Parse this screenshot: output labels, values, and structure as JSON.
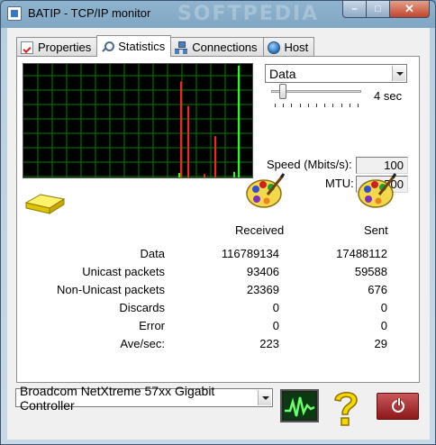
{
  "window": {
    "title": "BATIP - TCP/IP monitor",
    "watermark": "SOFTPEDIA",
    "minimize_glyph": "–",
    "maximize_glyph": "□",
    "close_glyph": "✕"
  },
  "tabs": [
    {
      "label": "Properties",
      "icon": "checklist-icon",
      "active": false
    },
    {
      "label": "Statistics",
      "icon": "magnifier-icon",
      "active": true
    },
    {
      "label": "Connections",
      "icon": "network-icon",
      "active": false
    },
    {
      "label": "Host",
      "icon": "globe-icon",
      "active": false
    }
  ],
  "statistics": {
    "view_select": "Data",
    "interval_label": "4 sec",
    "interval_slider_fraction": 0.1,
    "speed_label": "Speed (Mbits/s):",
    "speed_value": "100",
    "mtu_label": "MTU:",
    "mtu_value": "1500",
    "received_header": "Received",
    "sent_header": "Sent",
    "rows": [
      {
        "label": "Data",
        "received": "116789134",
        "sent": "17488112"
      },
      {
        "label": "Unicast packets",
        "received": "93406",
        "sent": "59588"
      },
      {
        "label": "Non-Unicast packets",
        "received": "23369",
        "sent": "676"
      },
      {
        "label": "Discards",
        "received": "0",
        "sent": "0"
      },
      {
        "label": "Error",
        "received": "0",
        "sent": "0"
      },
      {
        "label": "Ave/sec:",
        "received": "223",
        "sent": "29"
      }
    ],
    "graph": {
      "grid_color": "#008000",
      "background": "#000000",
      "received_color": "#ff2020",
      "sent_color": "#20ff20",
      "spikes": [
        {
          "pos": 0.69,
          "level": 0.86,
          "color": "red"
        },
        {
          "pos": 0.72,
          "level": 0.64,
          "color": "red"
        },
        {
          "pos": 0.84,
          "level": 0.37,
          "color": "red"
        },
        {
          "pos": 0.79,
          "level": 0.03,
          "color": "red"
        },
        {
          "pos": 0.94,
          "level": 1.0,
          "color": "green"
        },
        {
          "pos": 0.92,
          "level": 0.05,
          "color": "green"
        },
        {
          "pos": 0.68,
          "level": 0.04,
          "color": "green"
        }
      ]
    }
  },
  "footer": {
    "adapter_select": "Broadcom NetXtreme 57xx Gigabit Controller"
  },
  "colors": {
    "accent": "#3a78c2",
    "power_button": "#a42020",
    "help_icon": "#f6d800"
  }
}
